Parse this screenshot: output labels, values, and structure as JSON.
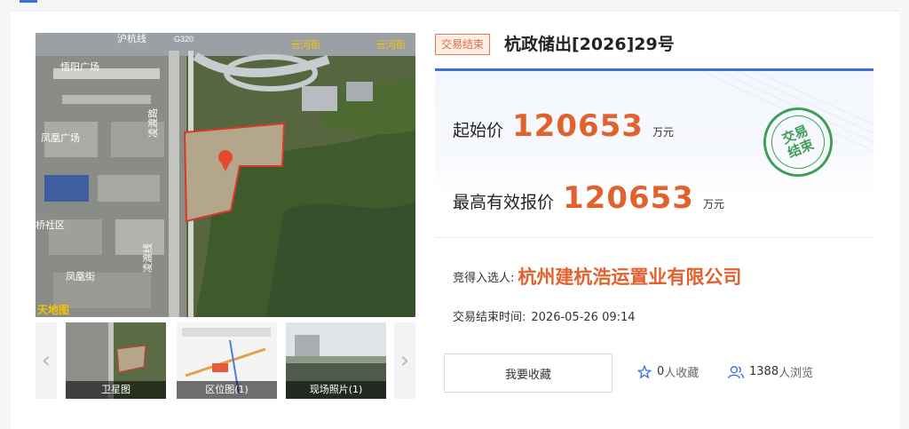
{
  "listing": {
    "status": "交易结束",
    "title": "杭政储出[2026]29号",
    "start_price_label": "起始价",
    "start_price": "120653",
    "start_price_unit": "万元",
    "top_bid_label": "最高有效报价",
    "top_bid": "120653",
    "top_bid_unit": "万元",
    "stamp_line1": "交易",
    "stamp_line2": "结束",
    "winner_label": "竞得入选人:",
    "winner": "杭州建杭浩运置业有限公司",
    "end_time_label": "交易结束时间:",
    "end_time": "2026-05-26 09:14"
  },
  "map": {
    "labels": [
      "沪杭线",
      "云河街",
      "云河街",
      "G320",
      "悟阳广场",
      "凤凰广场",
      "凌渡路",
      "桥社区",
      "凤凰街",
      "凌渡线",
      "天地图"
    ]
  },
  "thumbnails": [
    {
      "caption": "卫星图"
    },
    {
      "caption": "区位图(1)"
    },
    {
      "caption": "现场照片(1)"
    }
  ],
  "actions": {
    "favorite_button": "我要收藏",
    "favorites_count": "0",
    "favorites_suffix": "人收藏",
    "views_count": "1388",
    "views_suffix": "人浏览"
  },
  "colors": {
    "accent_orange": "#e1622e",
    "brand_blue": "#3f6fd8",
    "stamp_green": "#3f9d57"
  }
}
